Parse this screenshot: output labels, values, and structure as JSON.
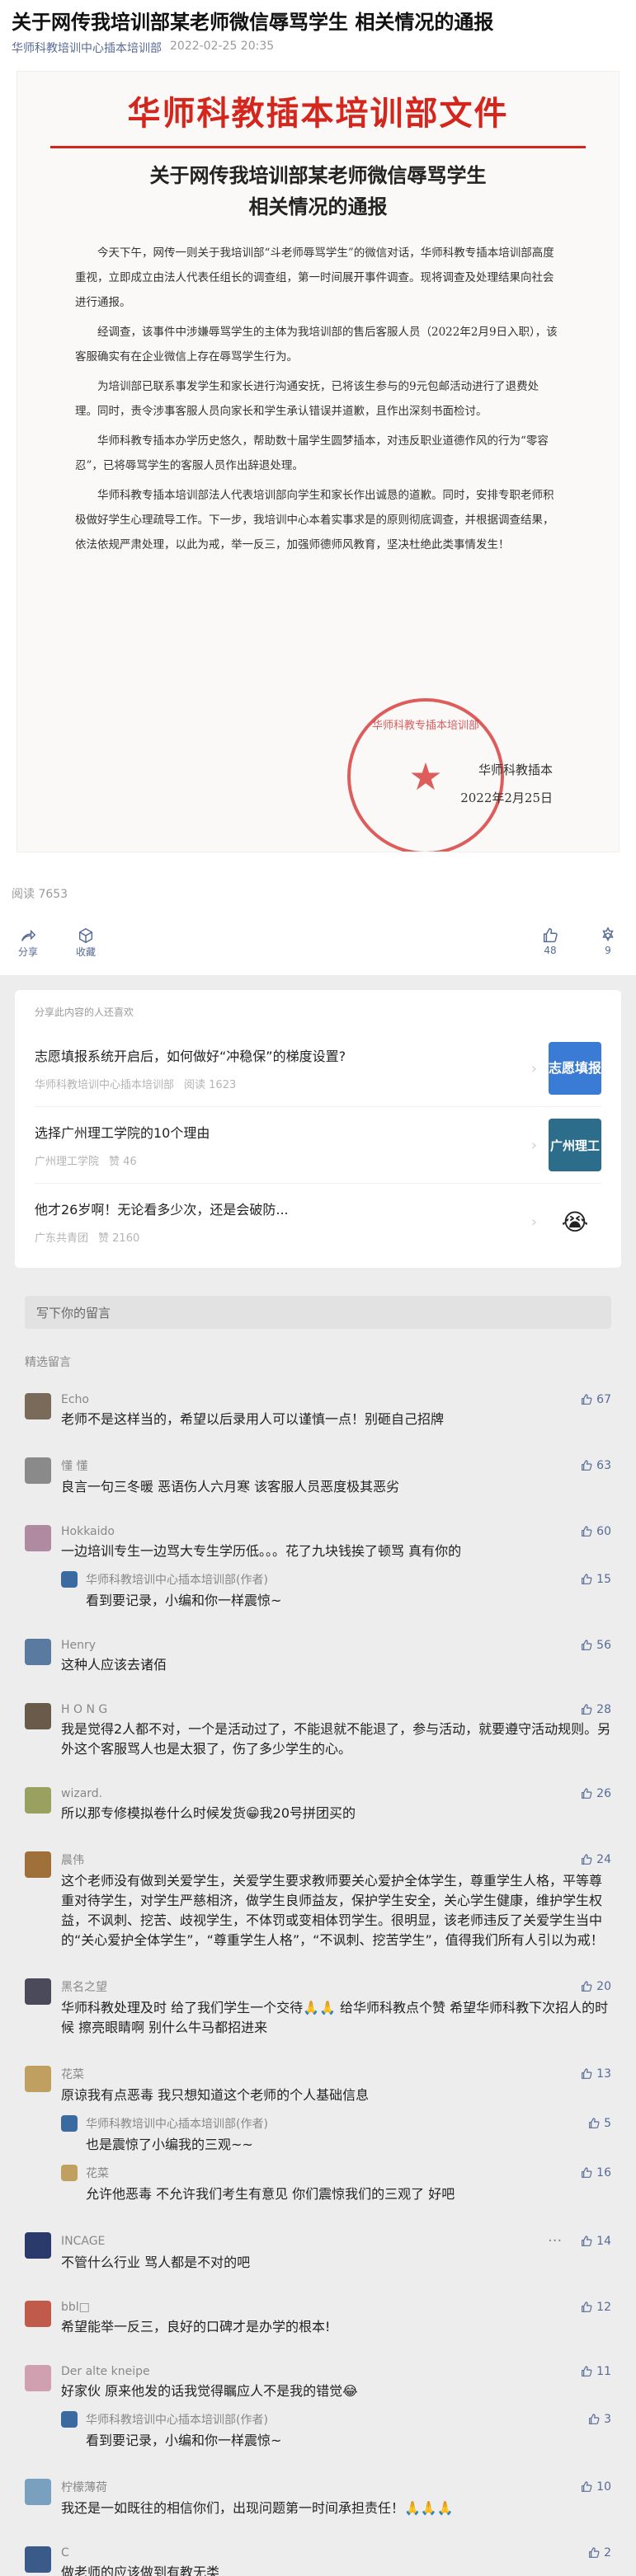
{
  "article": {
    "title": "关于网传我培训部某老师微信辱骂学生 相关情况的通报",
    "account": "华师科教培训中心插本培训部",
    "date": "2022-02-25 20:35"
  },
  "document": {
    "header": "华师科教插本培训部文件",
    "subtitle_1": "关于网传我培训部某老师微信辱骂学生",
    "subtitle_2": "相关情况的通报",
    "paragraphs": [
      "今天下午，网传一则关于我培训部“斗老师辱骂学生”的微信对话，华师科教专插本培训部高度重视，立即成立由法人代表任组长的调查组，第一时间展开事件调查。现将调查及处理结果向社会进行通报。",
      "经调查，该事件中涉嫌辱骂学生的主体为我培训部的售后客服人员（2022年2月9日入职），该客服确实有在企业微信上存在辱骂学生行为。",
      "为培训部已联系事发学生和家长进行沟通安抚，已将该生参与的9元包邮活动进行了退费处理。同时，责令涉事客服人员向家长和学生承认错误并道歉，且作出深刻书面检讨。",
      "华师科教专插本办学历史悠久，帮助数十届学生圆梦插本，对违反职业道德作风的行为“零容忍”，已将辱骂学生的客服人员作出辞退处理。",
      "华师科教专插本培训部法人代表培训部向学生和家长作出诚恳的道歉。同时，安排专职老师积极做好学生心理疏导工作。下一步，我培训中心本着实事求是的原则彻底调查，并根据调查结果，依法依规严肃处理，以此为戒，举一反三，加强师德师风教育，坚决杜绝此类事情发生！"
    ],
    "sign_org": "华师科教插本",
    "sign_date": "2022年2月25日",
    "seal_text": "华师科教专插本培训部"
  },
  "reads": "阅读 7653",
  "actions": {
    "share": "分享",
    "favorite": "收藏",
    "like_count": "48",
    "wow_count": "9"
  },
  "recommend": {
    "header": "分享此内容的人还喜欢",
    "items": [
      {
        "title": "志愿填报系统开启后，如何做好“冲稳保”的梯度设置?",
        "source": "华师科教培训中心插本培训部",
        "stat": "阅读 1623",
        "thumb_text": "志愿填报",
        "thumb_color": "#3a7bd5"
      },
      {
        "title": "选择广州理工学院的10个理由",
        "source": "广州理工学院",
        "stat": "赞 46",
        "thumb_text": "广州理工",
        "thumb_color": "#2d6d8c"
      },
      {
        "title": "他才26岁啊！无论看多少次，还是会破防...",
        "source": "广东共青团",
        "stat": "赞 2160",
        "thumb_text": "😭",
        "thumb_color": "#ffffff"
      }
    ]
  },
  "write_placeholder": "写下你的留言",
  "selected_header": "精选留言",
  "comments": [
    {
      "name": "Echo",
      "likes": "67",
      "text": "老师不是这样当的，希望以后录用人可以谨慎一点！别砸自己招牌",
      "color": "#7a6a5a"
    },
    {
      "name": "懂 懂",
      "likes": "63",
      "text": "良言一句三冬暖 恶语伤人六月寒 该客服人员恶度极其恶劣",
      "color": "#8a8a8a"
    },
    {
      "name": "Hokkaido",
      "likes": "60",
      "text": "一边培训专生一边骂大专生学历低。。。花了九块钱挨了顿骂 真有你的",
      "color": "#b08aa0",
      "reply": {
        "name": "华师科教培训中心插本培训部(作者)",
        "likes": "15",
        "text": "看到要记录，小编和你一样震惊~"
      }
    },
    {
      "name": "Henry",
      "likes": "56",
      "text": "这种人应该去诸佰",
      "color": "#5a7aa0"
    },
    {
      "name": "H O N G",
      "likes": "28",
      "text": "我是觉得2人都不对，一个是活动过了，不能退就不能退了，参与活动，就要遵守活动规则。另外这个客服骂人也是太狠了，伤了多少学生的心。",
      "color": "#6a5a4a"
    },
    {
      "name": "wizard.",
      "likes": "26",
      "text": "所以那专修模拟卷什么时候发货😁我20号拼团买的",
      "color": "#9aa060"
    },
    {
      "name": "晨伟",
      "likes": "24",
      "text": "这个老师没有做到关爱学生，关爱学生要求教师要关心爱护全体学生，尊重学生人格，平等尊重对待学生，对学生严慈相济，做学生良师益友，保护学生安全，关心学生健康，维护学生权益，不讽刺、挖苦、歧视学生，不体罚或变相体罚学生。很明显，该老师违反了关爱学生当中的“关心爱护全体学生”，“尊重学生人格”，“不讽刺、挖苦学生”，值得我们所有人引以为戒！",
      "color": "#a0703a"
    },
    {
      "name": "黑名之望",
      "likes": "20",
      "text": "华师科教处理及时 给了我们学生一个交待🙏🙏 给华师科教点个赞 希望华师科教下次招人的时候 擦亮眼睛啊 别什么牛马都招进来",
      "color": "#4a4a5a"
    },
    {
      "name": "花菜",
      "likes": "13",
      "text": "原谅我有点恶毒 我只想知道这个老师的个人基础信息",
      "color": "#c0a060",
      "reply": {
        "name": "华师科教培训中心插本培训部(作者)",
        "likes": "5",
        "text": "也是震惊了小编我的三观~~"
      },
      "reply2": {
        "name": "花菜",
        "likes": "16",
        "text": "允许他恶毒 不允许我们考生有意见  你们震惊我们的三观了 好吧"
      }
    },
    {
      "name": "INCAGE",
      "likes": "14",
      "text": "不管什么行业 骂人都是不对的吧",
      "color": "#2a3a6a",
      "dots": "···"
    },
    {
      "name": "bbl□",
      "likes": "12",
      "text": "希望能举一反三，良好的口碑才是办学的根本!",
      "color": "#c05a4a"
    },
    {
      "name": "Der alte kneipe",
      "likes": "11",
      "text": "好家伙 原来他发的话我觉得瞩应人不是我的错觉😂",
      "color": "#d0a0b0",
      "reply": {
        "name": "华师科教培训中心插本培训部(作者)",
        "likes": "3",
        "text": "看到要记录，小编和你一样震惊~"
      }
    },
    {
      "name": "柠檬薄荷",
      "likes": "10",
      "text": "我还是一如既往的相信你们，出现问题第一时间承担责任！🙏🙏🙏",
      "color": "#7aa0c0"
    },
    {
      "name": "C",
      "likes": "2",
      "text": "做老师的应该做到有教无类",
      "color": "#3a5a8a"
    }
  ]
}
